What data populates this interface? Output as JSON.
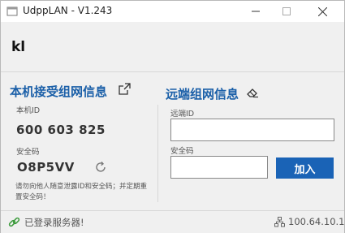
{
  "window": {
    "title": "UdppLAN - V1.243"
  },
  "header": {
    "username": "kl"
  },
  "local": {
    "title": "本机接受组网信息",
    "id_label": "本机ID",
    "id_value": "600 603 825",
    "code_label": "安全码",
    "code_value": "O8P5VV",
    "hint": "请勿向他人随意泄露ID和安全码；并定期重置安全码！"
  },
  "remote": {
    "title": "远端组网信息",
    "id_label": "远端ID",
    "id_value": "",
    "code_label": "安全码",
    "code_value": "",
    "join_label": "加入"
  },
  "status": {
    "text": "已登录服务器!",
    "ip": "100.64.10.1"
  },
  "colors": {
    "accent": "#1a5fa8",
    "button": "#1a63b6",
    "link_icon": "#3a9a3a"
  }
}
